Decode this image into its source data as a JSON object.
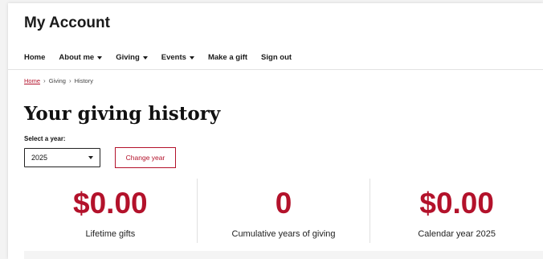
{
  "header": {
    "title": "My Account"
  },
  "nav": {
    "items": [
      {
        "label": "Home",
        "dropdown": false
      },
      {
        "label": "About me",
        "dropdown": true
      },
      {
        "label": "Giving",
        "dropdown": true
      },
      {
        "label": "Events",
        "dropdown": true
      },
      {
        "label": "Make a gift",
        "dropdown": false
      },
      {
        "label": "Sign out",
        "dropdown": false
      }
    ]
  },
  "breadcrumb": {
    "home": "Home",
    "giving": "Giving",
    "current": "History",
    "separator": "›"
  },
  "page": {
    "title": "Your giving history"
  },
  "year_form": {
    "label": "Select a year:",
    "selected": "2025",
    "button_label": "Change year"
  },
  "stats": [
    {
      "value": "$0.00",
      "label": "Lifetime gifts"
    },
    {
      "value": "0",
      "label": "Cumulative years of giving"
    },
    {
      "value": "$0.00",
      "label": "Calendar year 2025"
    }
  ],
  "colors": {
    "accent": "#b3122b",
    "text": "#111111",
    "divider": "#e2e2e2"
  }
}
